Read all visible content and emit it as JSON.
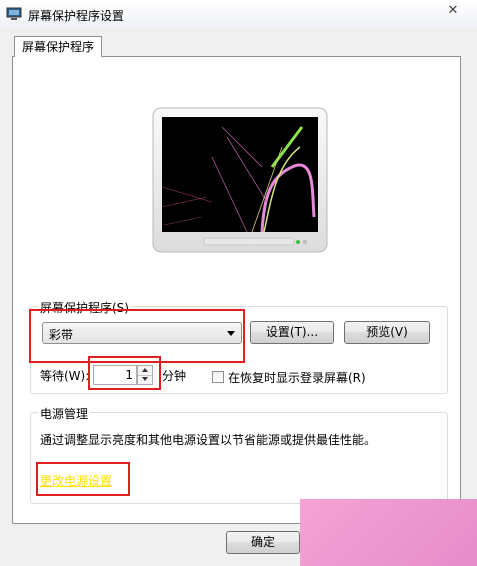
{
  "window": {
    "title": "屏幕保护程序设置",
    "close_glyph": "✕"
  },
  "tab": {
    "label": "屏幕保护程序"
  },
  "screensaver": {
    "group_label": "屏幕保护程序(S)",
    "selected": "彩带",
    "settings_button": "设置(T)...",
    "preview_button": "预览(V)",
    "wait_label": "等待(W):",
    "wait_value": "1",
    "wait_unit": "分钟",
    "resume_checkbox_label": "在恢复时显示登录屏幕(R)",
    "resume_checked": false
  },
  "power": {
    "group_label": "电源管理",
    "description": "通过调整显示亮度和其他电源设置以节省能源或提供最佳性能。",
    "link_text": "更改电源设置"
  },
  "footer": {
    "ok_button": "确定"
  },
  "colors": {
    "highlight": "#e02020",
    "link": "#ffe000",
    "watermark": "#ee99cc"
  }
}
